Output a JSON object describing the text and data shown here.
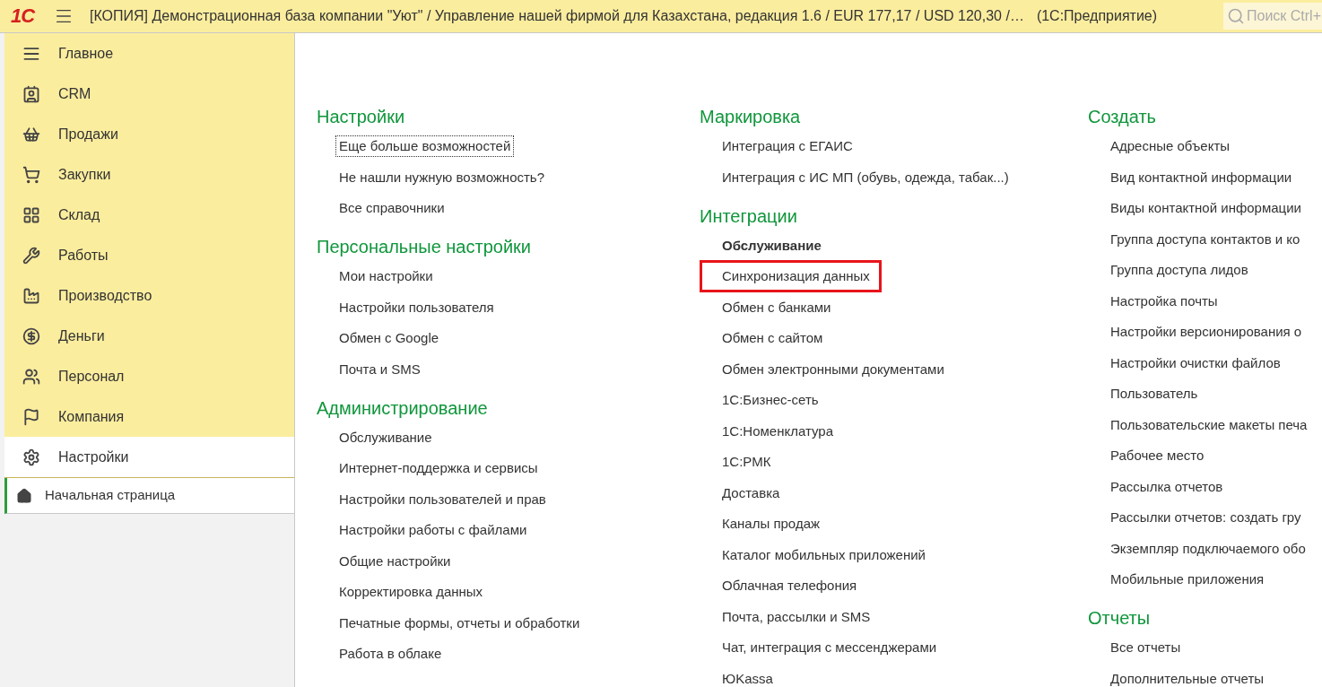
{
  "header": {
    "logo": "1С",
    "title": "[КОПИЯ] Демонстрационная база компании \"Уют\" / Управление нашей фирмой для Казахстана, редакция 1.6 / EUR 177,17 / USD 120,30 /…",
    "app": "(1С:Предприятие)",
    "search": {
      "placeholder": "Поиск Ctrl+"
    }
  },
  "sidebar": {
    "items": [
      {
        "label": "Главное",
        "selected": false
      },
      {
        "label": "CRM",
        "selected": false
      },
      {
        "label": "Продажи",
        "selected": false
      },
      {
        "label": "Закупки",
        "selected": false
      },
      {
        "label": "Склад",
        "selected": false
      },
      {
        "label": "Работы",
        "selected": false
      },
      {
        "label": "Производство",
        "selected": false
      },
      {
        "label": "Деньги",
        "selected": false
      },
      {
        "label": "Персонал",
        "selected": false
      },
      {
        "label": "Компания",
        "selected": false
      },
      {
        "label": "Настройки",
        "selected": true
      }
    ],
    "open_tabs": [
      {
        "label": "Начальная страница",
        "selected": true
      }
    ]
  },
  "columns": [
    {
      "sections": [
        {
          "title": "Настройки",
          "items": [
            {
              "label": "Еще больше возможностей",
              "kind": "focused"
            },
            {
              "label": "Не нашли нужную возможность?",
              "kind": "link"
            },
            {
              "label": "Все справочники",
              "kind": "link"
            }
          ]
        },
        {
          "title": "Персональные настройки",
          "items": [
            {
              "label": "Мои настройки",
              "kind": "link"
            },
            {
              "label": "Настройки пользователя",
              "kind": "link"
            },
            {
              "label": "Обмен с Google",
              "kind": "link"
            },
            {
              "label": "Почта и SMS",
              "kind": "link"
            }
          ]
        },
        {
          "title": "Администрирование",
          "items": [
            {
              "label": "Обслуживание",
              "kind": "link"
            },
            {
              "label": "Интернет-поддержка и сервисы",
              "kind": "link"
            },
            {
              "label": "Настройки пользователей и прав",
              "kind": "link"
            },
            {
              "label": "Настройки работы с файлами",
              "kind": "link"
            },
            {
              "label": "Общие настройки",
              "kind": "link"
            },
            {
              "label": "Корректировка данных",
              "kind": "link"
            },
            {
              "label": "Печатные формы, отчеты и обработки",
              "kind": "link"
            },
            {
              "label": "Работа в облаке",
              "kind": "link"
            }
          ]
        }
      ]
    },
    {
      "sections": [
        {
          "title": "Маркировка",
          "items": [
            {
              "label": "Интеграция с ЕГАИС",
              "kind": "link"
            },
            {
              "label": "Интеграция с ИС МП (обувь, одежда, табак...)",
              "kind": "link"
            }
          ]
        },
        {
          "title": "Интеграции",
          "items": [
            {
              "label": "Обслуживание",
              "kind": "bold"
            },
            {
              "label": "Синхронизация данных",
              "kind": "marked"
            },
            {
              "label": "Обмен с банками",
              "kind": "link"
            },
            {
              "label": "Обмен с сайтом",
              "kind": "link"
            },
            {
              "label": "Обмен электронными документами",
              "kind": "link"
            },
            {
              "label": "1С:Бизнес-сеть",
              "kind": "link"
            },
            {
              "label": "1С:Номенклатура",
              "kind": "link"
            },
            {
              "label": "1С:РМК",
              "kind": "link"
            },
            {
              "label": "Доставка",
              "kind": "link"
            },
            {
              "label": "Каналы продаж",
              "kind": "link"
            },
            {
              "label": "Каталог мобильных приложений",
              "kind": "link"
            },
            {
              "label": "Облачная телефония",
              "kind": "link"
            },
            {
              "label": "Почта, рассылки и SMS",
              "kind": "link"
            },
            {
              "label": "Чат, интеграция с мессенджерами",
              "kind": "link"
            },
            {
              "label": "ЮKassa",
              "kind": "link"
            }
          ]
        }
      ]
    },
    {
      "sections": [
        {
          "title": "Создать",
          "items": [
            {
              "label": "Адресные объекты",
              "kind": "link"
            },
            {
              "label": "Вид контактной информации",
              "kind": "link"
            },
            {
              "label": "Виды контактной информации",
              "kind": "link"
            },
            {
              "label": "Группа доступа контактов и ко",
              "kind": "link"
            },
            {
              "label": "Группа доступа лидов",
              "kind": "link"
            },
            {
              "label": "Настройка почты",
              "kind": "link"
            },
            {
              "label": "Настройки версионирования о",
              "kind": "link"
            },
            {
              "label": "Настройки очистки файлов",
              "kind": "link"
            },
            {
              "label": "Пользователь",
              "kind": "link"
            },
            {
              "label": "Пользовательские макеты печа",
              "kind": "link"
            },
            {
              "label": "Рабочее место",
              "kind": "link"
            },
            {
              "label": "Рассылка отчетов",
              "kind": "link"
            },
            {
              "label": "Рассылки отчетов: создать гру",
              "kind": "link"
            },
            {
              "label": "Экземпляр подключаемого обо",
              "kind": "link"
            },
            {
              "label": "Мобильные приложения",
              "kind": "link"
            }
          ]
        },
        {
          "title": "Отчеты",
          "items": [
            {
              "label": "Все отчеты",
              "kind": "link"
            },
            {
              "label": "Дополнительные отчеты",
              "kind": "link"
            }
          ]
        }
      ]
    }
  ]
}
